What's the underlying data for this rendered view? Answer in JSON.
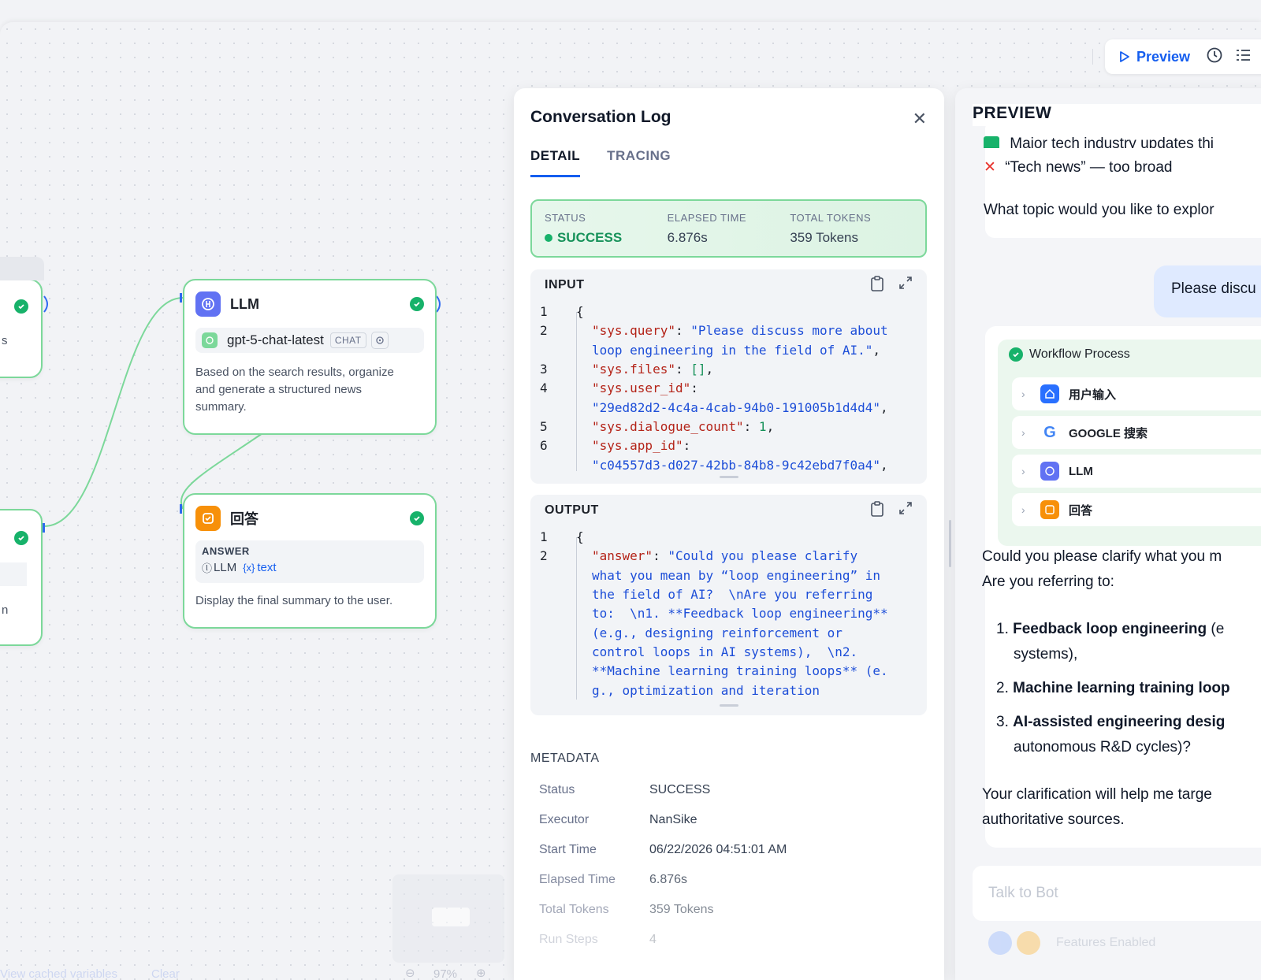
{
  "toolbar": {
    "preview_label": "Preview"
  },
  "nodes": {
    "llm": {
      "title": "LLM",
      "model": "gpt-5-chat-latest",
      "model_badge": "CHAT",
      "description_lines": [
        "Based on the search results, organize",
        "and generate a structured news",
        "summary."
      ]
    },
    "answer": {
      "title": "回答",
      "section_label": "ANSWER",
      "var_source": "LLM",
      "var_name": "text",
      "description": "Display the final summary to the user."
    },
    "left_partial": {
      "text1": "s",
      "text2": "n"
    }
  },
  "log": {
    "title": "Conversation Log",
    "tabs": [
      {
        "label": "DETAIL"
      },
      {
        "label": "TRACING"
      }
    ],
    "status": {
      "status_label": "STATUS",
      "status_value": "SUCCESS",
      "elapsed_label": "ELAPSED TIME",
      "elapsed_value": "6.876s",
      "tokens_label": "TOTAL TOKENS",
      "tokens_value": "359 Tokens"
    },
    "input": {
      "label": "INPUT",
      "line_numbers": [
        "1",
        "2",
        "3",
        "4",
        "5",
        "6"
      ],
      "brace": "{",
      "query_key": "\"sys.query\"",
      "query_val_1": "\"Please discuss more about",
      "query_val_2": "loop engineering in the field of AI.\"",
      "files_key": "\"sys.files\"",
      "files_val": "[]",
      "user_key": "\"sys.user_id\"",
      "user_val": "\"29ed82d2-4c4a-4cab-94b0-191005b1d4d4\"",
      "dialogue_key": "\"sys.dialogue_count\"",
      "dialogue_val": "1",
      "app_key": "\"sys.app_id\"",
      "app_val": "\"c04557d3-d027-42bb-84b8-9c42ebd7f0a4\""
    },
    "output": {
      "label": "OUTPUT",
      "line_numbers": [
        "1",
        "2"
      ],
      "brace": "{",
      "answer_key": "\"answer\"",
      "answer_lines": [
        "\"Could you please clarify",
        "what you mean by “loop engineering” in",
        "the field of AI?  \\nAre you referring",
        "to:  \\n1. **Feedback loop engineering**",
        "(e.g., designing reinforcement or",
        "control loops in AI systems),  \\n2.",
        "**Machine learning training loops** (e.",
        "g., optimization and iteration"
      ]
    },
    "metadata": {
      "title": "METADATA",
      "rows": [
        {
          "k": "Status",
          "v": "SUCCESS"
        },
        {
          "k": "Executor",
          "v": "NanSike"
        },
        {
          "k": "Start Time",
          "v": "06/22/2026 04:51:01 AM"
        },
        {
          "k": "Elapsed Time",
          "v": "6.876s"
        },
        {
          "k": "Total Tokens",
          "v": "359 Tokens"
        },
        {
          "k": "Run Steps",
          "v": "4"
        }
      ]
    }
  },
  "preview": {
    "title": "PREVIEW",
    "top_lines": [
      "Major tech industry updates thi",
      "“Tech news” — too broad",
      "What topic would you like to explor"
    ],
    "user_message": "Please discu",
    "workflow": {
      "title": "Workflow Process",
      "items": [
        {
          "label": "用户输入"
        },
        {
          "label": "GOOGLE 搜索"
        },
        {
          "label": "LLM"
        },
        {
          "label": "回答"
        }
      ]
    },
    "answer": {
      "intro_1": "Could you please clarify what you m",
      "intro_2": "Are you referring to:",
      "item1_bold": "Feedback loop engineering",
      "item1_rest": " (e",
      "item1_line2": "systems),",
      "item2_bold": "Machine learning training loop",
      "item3_bold": "AI-assisted engineering desig",
      "item3_line2": "autonomous R&D cycles)?",
      "outro_1": "Your clarification will help me targe",
      "outro_2": "authoritative sources."
    },
    "input_placeholder": "Talk to Bot",
    "features_label": "Features Enabled"
  },
  "canvas_footer": {
    "cached": "View cached variables",
    "clear": "Clear",
    "zoom": "97%"
  }
}
